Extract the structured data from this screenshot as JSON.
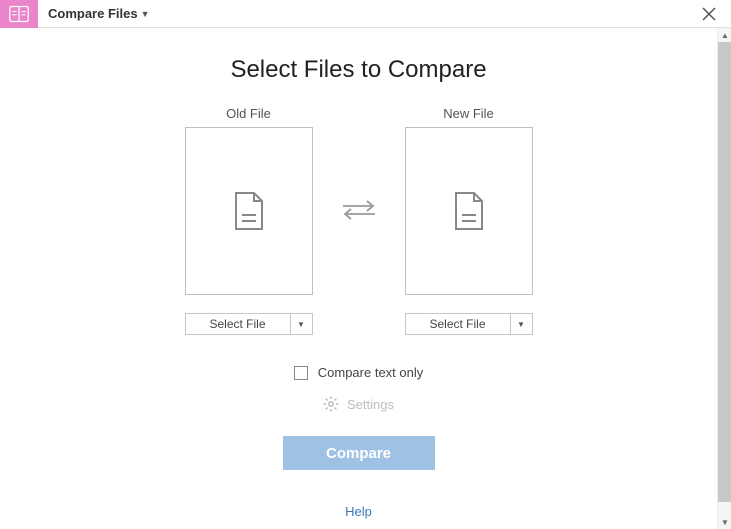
{
  "header": {
    "title": "Compare Files"
  },
  "main": {
    "title": "Select Files to Compare",
    "old_label": "Old File",
    "new_label": "New File",
    "select_label": "Select File",
    "compare_text_only": "Compare text only",
    "settings_label": "Settings",
    "compare_button": "Compare",
    "help_label": "Help"
  }
}
